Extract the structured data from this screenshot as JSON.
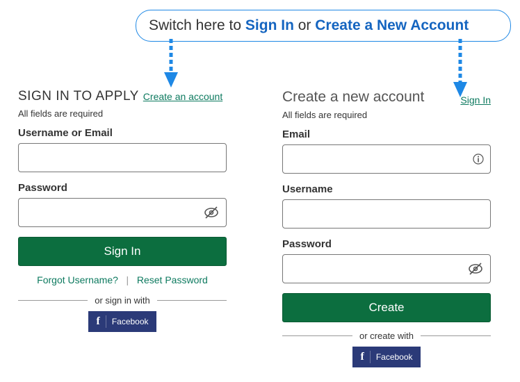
{
  "callout": {
    "pre": "Switch here to ",
    "signin": "Sign In",
    "mid": " or ",
    "create": "Create a New Account"
  },
  "signin_panel": {
    "title": "SIGN IN TO APPLY",
    "create_link": "Create an account",
    "required": "All fields are required",
    "username_label": "Username or Email",
    "password_label": "Password",
    "signin_btn": "Sign In",
    "forgot_username": "Forgot Username?",
    "reset_password": "Reset Password",
    "divider": "or sign in with",
    "facebook": "Facebook"
  },
  "create_panel": {
    "title": "Create a new account",
    "signin_link": "Sign In",
    "required": "All fields are required",
    "email_label": "Email",
    "username_label": "Username",
    "password_label": "Password",
    "create_btn": "Create",
    "divider": "or create with",
    "facebook": "Facebook"
  }
}
